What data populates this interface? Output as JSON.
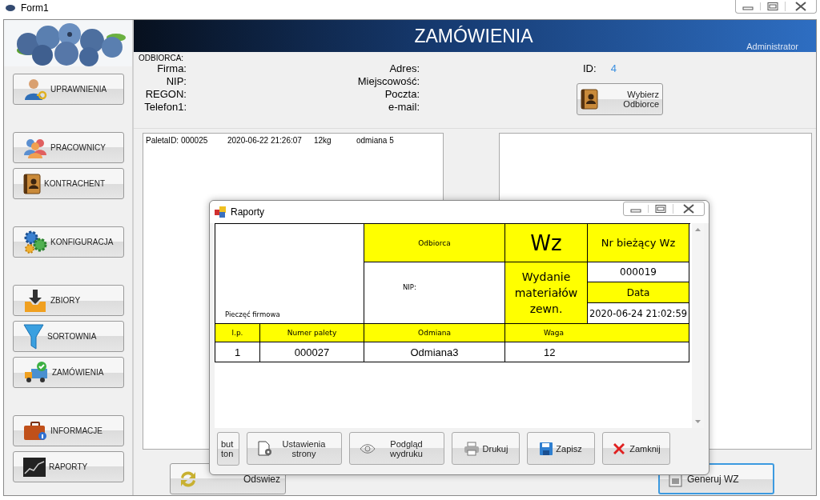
{
  "window": {
    "title": "Form1"
  },
  "sidebar": {
    "groups": [
      {
        "buttons": [
          {
            "label": "UPRAWNIENIA"
          }
        ]
      },
      {
        "buttons": [
          {
            "label": "PRACOWNICY"
          },
          {
            "label": "KONTRACHENT"
          }
        ]
      },
      {
        "buttons": [
          {
            "label": "KONFIGURACJA"
          }
        ]
      },
      {
        "buttons": [
          {
            "label": "ZBIORY"
          },
          {
            "label": "SORTOWNIA"
          },
          {
            "label": "ZAMÓWIENIA"
          }
        ]
      },
      {
        "buttons": [
          {
            "label": "INFORMACJE"
          },
          {
            "label": "RAPORTY"
          }
        ]
      }
    ]
  },
  "header": {
    "title": "ZAMÓWIENIA",
    "user": "Administrator"
  },
  "recipient": {
    "legend": "ODBIORCA:",
    "left_labels": [
      "Firma:",
      "NIP:",
      "REGON:",
      "Telefon1:"
    ],
    "right_labels": [
      "Adres:",
      "Miejscowość:",
      "Poczta:",
      "e-mail:"
    ],
    "id_label": "ID:",
    "id_value": "4",
    "choose_button": "Wybierz Odbiorce"
  },
  "left_list": {
    "items": [
      {
        "cells": [
          "PaletaID: 000025",
          "2020-06-22 21:26:07",
          "12kg",
          "odmiana 5"
        ]
      }
    ]
  },
  "actions": [
    {
      "label": "Odswiez",
      "focused": false
    },
    {
      "label": "Generuj WZ",
      "focused": true
    }
  ],
  "dialog": {
    "title": "Raporty",
    "report": {
      "stamp": "Pieczęć firmowa",
      "recipient": "Odbiorca",
      "nip": "NIP:",
      "doc": "Wz",
      "doc_name": "Wydanie materiałów zewn.",
      "number_label": "Nr bieżący Wz",
      "number": "000019",
      "date_label": "Data",
      "date": "2020-06-24 21:02:59",
      "columns": [
        "l.p.",
        "Numer palety",
        "Odmiana",
        "Waga"
      ],
      "rows": [
        [
          "1",
          "000027",
          "Odmiana3",
          "12"
        ]
      ]
    },
    "toolbar": [
      {
        "label": "button"
      },
      {
        "label": "Ustawienia strony"
      },
      {
        "label": "Podgląd wydruku"
      },
      {
        "label": "Drukuj"
      },
      {
        "label": "Zapisz"
      },
      {
        "label": "Zamknij"
      }
    ]
  }
}
